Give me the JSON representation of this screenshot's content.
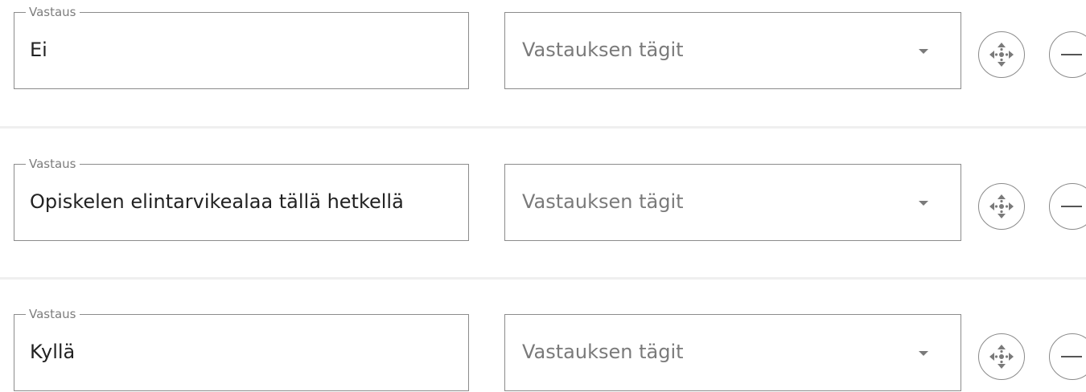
{
  "answers": [
    {
      "label": "Vastaus",
      "value": "Ei",
      "tags_placeholder": "Vastauksen tägit"
    },
    {
      "label": "Vastaus",
      "value": "Opiskelen elintarvikealaa tällä hetkellä",
      "tags_placeholder": "Vastauksen tägit"
    },
    {
      "label": "Vastaus",
      "value": "Kyllä",
      "tags_placeholder": "Vastauksen tägit"
    }
  ],
  "icons": {
    "move": "move-arrows-icon",
    "remove": "minus-icon",
    "dropdown": "caret-down-icon"
  },
  "colors": {
    "border": "#8c8c8c",
    "label": "#7d7d7d",
    "placeholder": "#7a7a7a",
    "text": "#222222",
    "divider": "#efefef"
  }
}
